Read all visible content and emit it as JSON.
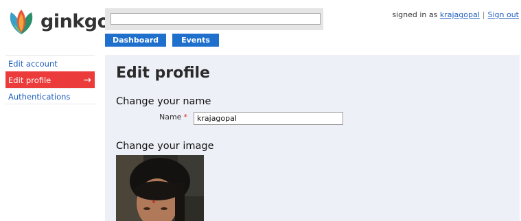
{
  "app": {
    "logo_text": "ginkgo"
  },
  "header": {
    "search": {
      "value": "",
      "placeholder": ""
    },
    "tabs": [
      {
        "label": "Dashboard"
      },
      {
        "label": "Events"
      }
    ],
    "user": {
      "signed_in_prefix": "signed in as",
      "username": "krajagopal",
      "separator": "|",
      "sign_out": "Sign out"
    }
  },
  "sidebar": {
    "items": [
      {
        "label": "Edit account",
        "active": false
      },
      {
        "label": "Edit profile",
        "active": true,
        "arrow": "→"
      },
      {
        "label": "Authentications",
        "active": false
      }
    ]
  },
  "main": {
    "title": "Edit profile",
    "name_section": {
      "heading": "Change your name",
      "label": "Name",
      "required_marker": "*",
      "value": "krajagopal"
    },
    "image_section": {
      "heading": "Change your image"
    }
  },
  "colors": {
    "tab_blue": "#1f6fcd",
    "active_red": "#ec3b3b",
    "link_blue": "#1f5fc0",
    "panel_bg": "#eef0f7"
  }
}
